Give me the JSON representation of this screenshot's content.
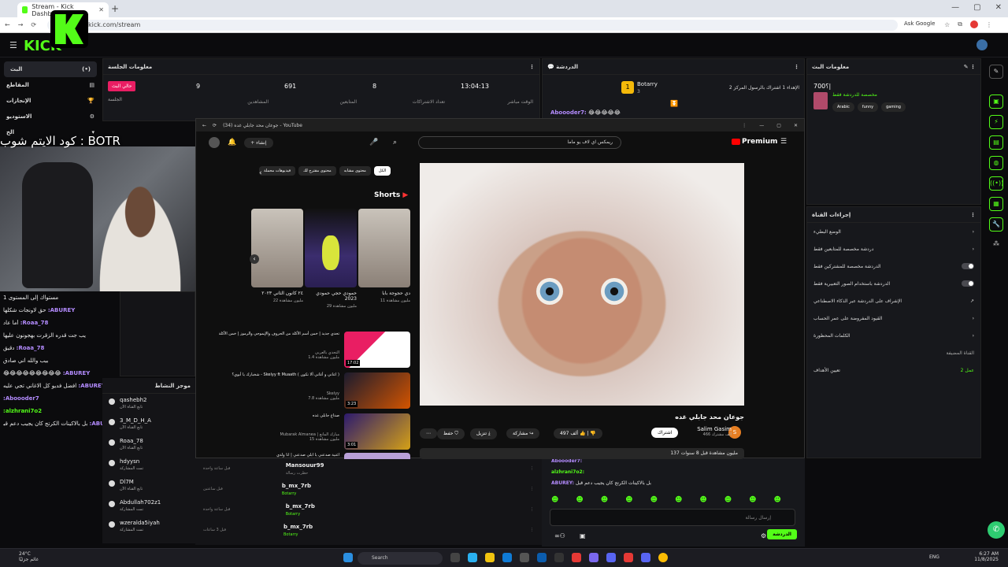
{
  "browser": {
    "tab_title": "Stream - Kick Dashboard",
    "url": "kick.com/stream",
    "ask_google": "Ask Google",
    "new_tab": "+"
  },
  "kick": {
    "logo_text": "KICK",
    "nav": [
      {
        "label": "البث",
        "icon": "(•)"
      },
      {
        "label": "المقاطع",
        "icon": "▤"
      },
      {
        "label": "الإنجازات",
        "icon": "🏆"
      },
      {
        "label": "الاستوديو",
        "icon": "⚙"
      },
      {
        "label": "الخ",
        "icon": "▾"
      }
    ]
  },
  "session": {
    "title": "معلومات الجلسة",
    "live_badge": "حالي البث",
    "session_label": "الجلسة",
    "stats": [
      {
        "value": "9",
        "label": "المشاهدين"
      },
      {
        "value": "691",
        "label": "المتابعين"
      },
      {
        "value": "8",
        "label": "تعداد الاشتراكات"
      },
      {
        "value": "13:04:13",
        "label": "الوقت مباشر"
      }
    ]
  },
  "chat": {
    "title": "الدردشة",
    "pinned_name": "Botarry",
    "pinned_count": "3",
    "pinned_text": "الإهداء 1 اشتراك بالرسول المركز 2",
    "top_msg_user": "Aboooder7:",
    "top_msg_text": "😂😂😂😂😂",
    "bottom_msgs": [
      {
        "user": "Aboooder7:",
        "text": ""
      },
      {
        "user": "alzhrani7o2:",
        "text": ""
      },
      {
        "user": "ABUREY:",
        "text": "بل بالاكينات الكرتج كان يجيب دعم قبل"
      }
    ],
    "input_placeholder": "إرسال رسالة",
    "send_label": "الدردشة"
  },
  "channel_info": {
    "title": "معلومات البث",
    "stream_title": "700؟|",
    "category": "مخصصة للدردشة فقط",
    "tags": [
      "Arabic",
      "funny",
      "gaming"
    ]
  },
  "channel_actions": {
    "title": "إجراءات القناة",
    "items": [
      {
        "label": "الوضع البطيء",
        "type": "arrow"
      },
      {
        "label": "دردشة مخصصة للمتابعين فقط",
        "type": "arrow"
      },
      {
        "label": "الدردشة مخصصة للمشتركين فقط",
        "type": "toggle"
      },
      {
        "label": "الدردشة باستخدام الصور التعبيرية فقط",
        "type": "toggle"
      },
      {
        "label": "الإشراف على الدردشة عبر الذكاء الاصطناعي",
        "type": "link"
      },
      {
        "label": "القيود المفروضة على عمر الحساب",
        "type": "arrow"
      },
      {
        "label": "الكلمات المحظورة",
        "type": "arrow"
      }
    ],
    "section_label": "القناة المضيفة",
    "goal_label": "تعيين الأهداف",
    "goal_badge": "عمل 2"
  },
  "overlay_text": "كود الايتم شوب : BOTR",
  "left_chat": [
    {
      "user": "",
      "text": "مستواك إلى المستوى 1"
    },
    {
      "user": "ABUREY:",
      "text": "حق لاونجات شكلها"
    },
    {
      "user": "Roaa_78:",
      "text": "أما عاد"
    },
    {
      "user": "",
      "text": "يب جت قدره الزقرت بهجونون عليها"
    },
    {
      "user": "Roaa_78:",
      "text": "دقيق"
    },
    {
      "user": "",
      "text": "بيب والله اني صادق"
    },
    {
      "user": "ABUREY:",
      "text": "😂😂😂😂😂😂😂😂😂"
    },
    {
      "user": "ABUREY:",
      "text": "افضل فديو كل الاغاني تجي عليه"
    },
    {
      "user": "Aboooder7:",
      "text": ""
    },
    {
      "user": "alzhrani7o2:",
      "text": ""
    },
    {
      "user": "ABUREY:",
      "text": "بل بالاكينات الكرتج كان يجيب دعم قبل"
    }
  ],
  "recent_events_title": "موجز النشاط",
  "followers": [
    {
      "name": "qashebh2",
      "sub": "تابع القناة الآن"
    },
    {
      "name": "3_M_D_H_A",
      "sub": "تابع القناة الآن"
    },
    {
      "name": "Roaa_78",
      "sub": "تابع القناة الآن"
    },
    {
      "name": "hdyysn",
      "sub": "تمت المشاركة"
    },
    {
      "name": "Dl7M",
      "sub": "تابع القناة الآن"
    },
    {
      "name": "Abdullah702z1",
      "sub": "تمت المشاركة"
    },
    {
      "name": "wzeralda5iyah",
      "sub": "تمت المشاركة"
    }
  ],
  "events_mid": [
    {
      "time": "قبل ساعة واحدة",
      "name": "Mansouur99",
      "detail": "حظرت رسالة"
    },
    {
      "time": "قبل ساعتين",
      "name": "b_mx_7rb",
      "detail": "Botarry"
    },
    {
      "time": "قبل ساعة واحدة",
      "name": "b_mx_7rb",
      "detail": "Botarry"
    },
    {
      "time": "قبل 3 ساعات",
      "name": "b_mx_7rb",
      "detail": "Botarry"
    }
  ],
  "youtube": {
    "window_title": "(34) جوعان محد جابلي غده - YouTube",
    "search_value": "ريمكس اي لاف يو ماما",
    "logo": "Premium",
    "create_label": "إنشاء",
    "chips": [
      "الكل",
      "محتوى مشابه",
      "محتوى مقترح لك",
      "فيديوهات محملة"
    ],
    "shorts_title": "Shorts",
    "shorts": [
      {
        "title": "دي حجوجة بابا",
        "meta": "11 مليون مشاهدة"
      },
      {
        "title": "حمودي حجي حمودي 2023",
        "meta": "29 مليون مشاهدة"
      },
      {
        "title": "٢٤ كانون الثاني ٢٠٢٣",
        "meta": "22 مليون مشاهدة"
      }
    ],
    "video_title": "جوعان محد جابلي غده",
    "channel_name": "Salim Gasim",
    "channel_subs": "466 ألف مشترك",
    "channel_avatar": "S",
    "subscribe": "اشتراك",
    "likes": "497 ألف",
    "share": "مشاركة",
    "download": "تنزيل",
    "save": "حفظ",
    "views_line": "137 مليون مشاهدة قبل 8 سنوات",
    "related": [
      {
        "title": "تحدي جديد | خمن أسم الأكلة من الحروف والإيموجي والرموز | خمن الأكلة",
        "channel": "التحدي بالعربي",
        "meta": "1.4 مليون مشاهدة",
        "dur": "17:02"
      },
      {
        "title": "شخبارك يا أبوي؟ - Skelyy ft Muaath ( اعاني و أغاني ألا تكون )",
        "channel": "Skelyy",
        "meta": "7.8 مليون مشاهدة",
        "dur": "3:23"
      },
      {
        "title": "صداع جابلي غده",
        "channel": "Mubarak Almanea | مبارك المانع",
        "meta": "15 مليون مشاهدة",
        "dur": "3:01"
      },
      {
        "title": "اغنية صدعني يا ابلي صدعني | أنا ولدي",
        "channel": "",
        "meta": "",
        "dur": ""
      }
    ]
  },
  "taskbar": {
    "search": "Search",
    "weather_temp": "24°C",
    "weather_desc": "غائم جزئيًا",
    "lang": "ENG",
    "time": "6:27 AM",
    "date": "11/8/2025"
  }
}
